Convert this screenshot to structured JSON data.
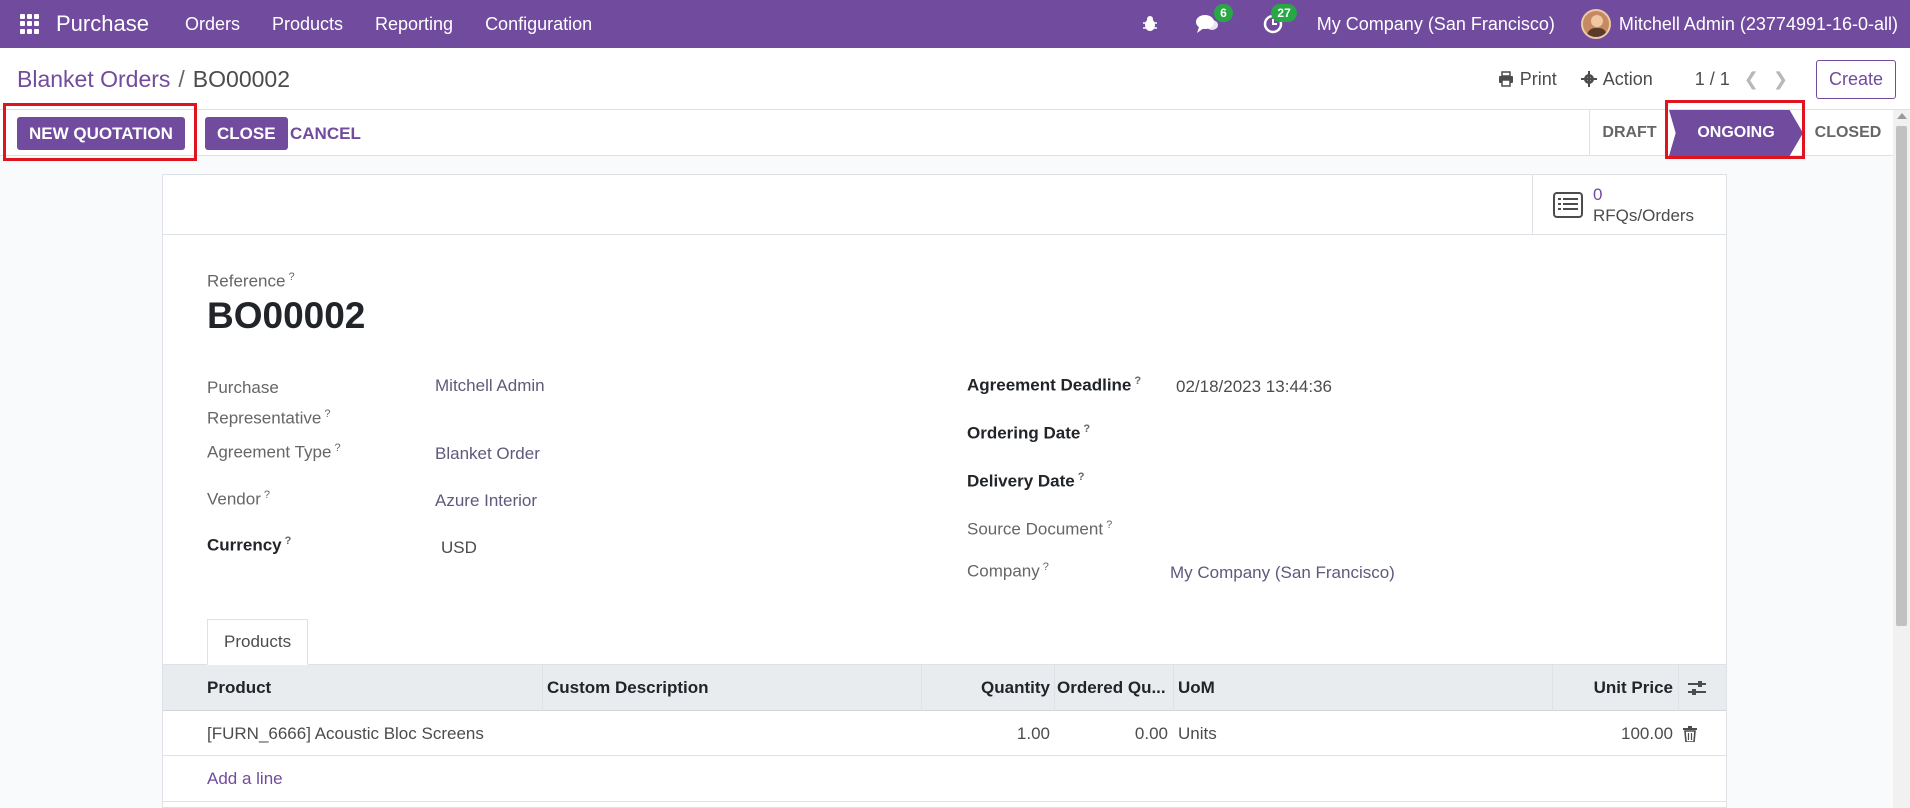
{
  "navbar": {
    "app_name": "Purchase",
    "menu": [
      "Orders",
      "Products",
      "Reporting",
      "Configuration"
    ],
    "messages_count": "6",
    "activities_count": "27",
    "company": "My Company (San Francisco)",
    "user": "Mitchell Admin (23774991-16-0-all)",
    "icons": [
      "apps-grid-icon",
      "bug-icon",
      "chat-icon",
      "clock-icon",
      "avatar"
    ]
  },
  "control": {
    "breadcrumb_parent": "Blanket Orders",
    "breadcrumb_separator": "/",
    "breadcrumb_current": "BO00002",
    "print_label": "Print",
    "action_label": "Action",
    "pager": "1 / 1",
    "create_label": "Create"
  },
  "statusbar": {
    "new_quotation": "NEW QUOTATION",
    "close": "CLOSE",
    "cancel": "CANCEL",
    "states": [
      "DRAFT",
      "ONGOING",
      "CLOSED"
    ],
    "active_state": "ONGOING"
  },
  "smart_button": {
    "count": "0",
    "label": "RFQs/Orders"
  },
  "form": {
    "reference_label": "Reference",
    "reference": "BO00002",
    "purchase_rep_label_1": "Purchase",
    "purchase_rep_label_2": "Representative",
    "purchase_rep": "Mitchell Admin",
    "agreement_type_label": "Agreement Type",
    "agreement_type": "Blanket Order",
    "vendor_label": "Vendor",
    "vendor": "Azure Interior",
    "currency_label": "Currency",
    "currency": "USD",
    "deadline_label": "Agreement Deadline",
    "deadline": "02/18/2023 13:44:36",
    "ordering_date_label": "Ordering Date",
    "delivery_date_label": "Delivery Date",
    "source_doc_label": "Source Document",
    "company_label": "Company",
    "company": "My Company (San Francisco)",
    "help_mark": "?"
  },
  "tabs": {
    "products": "Products"
  },
  "table": {
    "headers": {
      "product": "Product",
      "description": "Custom Description",
      "quantity": "Quantity",
      "ordered": "Ordered Qu...",
      "uom": "UoM",
      "unit_price": "Unit Price"
    },
    "rows": [
      {
        "product": "[FURN_6666] Acoustic Bloc Screens",
        "description": "",
        "quantity": "1.00",
        "ordered": "0.00",
        "uom": "Units",
        "unit_price": "100.00"
      }
    ],
    "add_line": "Add a line"
  },
  "colors": {
    "brand": "#714b9d",
    "highlight": "#e0141e",
    "badge": "#28a745"
  }
}
